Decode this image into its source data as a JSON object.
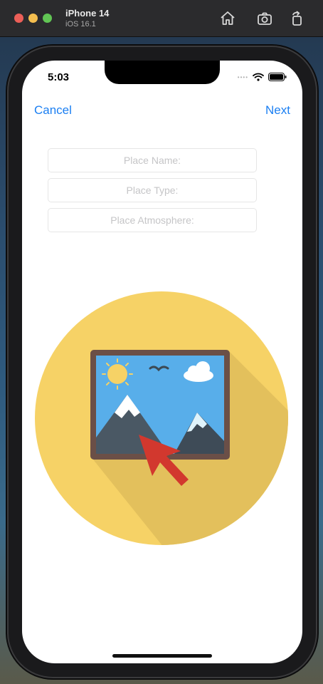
{
  "window": {
    "device_name": "iPhone 14",
    "os_version": "iOS 16.1",
    "toolbar_icons": [
      "home-icon",
      "screenshot-icon",
      "rotate-icon"
    ]
  },
  "status_bar": {
    "time": "5:03",
    "icons": [
      "cellular-dots-icon",
      "wifi-icon",
      "battery-icon"
    ]
  },
  "nav": {
    "cancel_label": "Cancel",
    "next_label": "Next"
  },
  "form": {
    "name_placeholder": "Place Name:",
    "type_placeholder": "Place Type:",
    "atmosphere_placeholder": "Place Atmosphere:"
  },
  "image_picker": {
    "icon": "image-upload-icon"
  },
  "colors": {
    "accent": "#1b7ff2",
    "circle": "#f6d266",
    "sky": "#58aeea",
    "frame": "#6b4f47",
    "cursor": "#d2382e"
  }
}
